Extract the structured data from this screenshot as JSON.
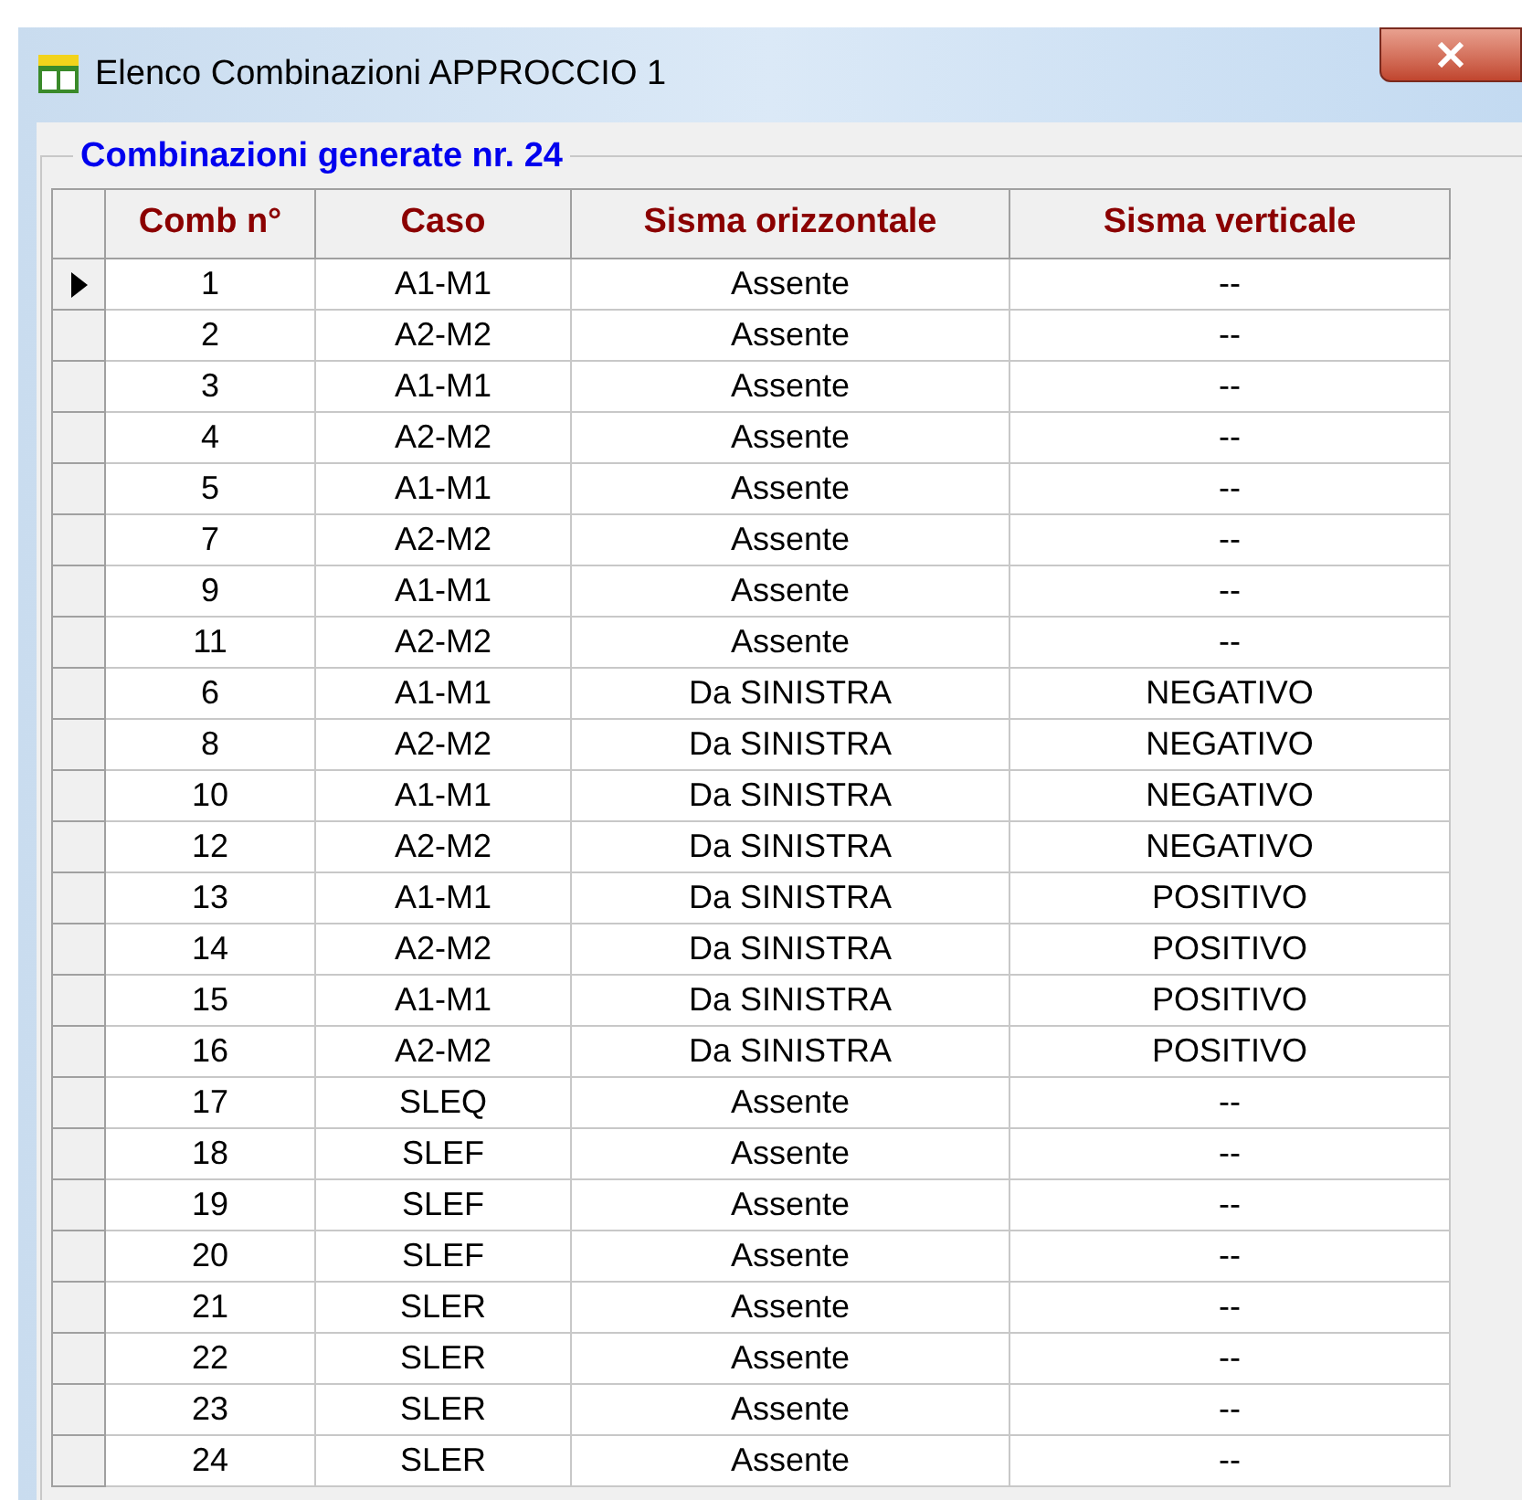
{
  "window": {
    "title": "Elenco Combinazioni APPROCCIO 1"
  },
  "group": {
    "title": "Combinazioni generate nr. 24"
  },
  "table": {
    "columns": [
      "Comb n°",
      "Caso",
      "Sisma orizzontale",
      "Sisma verticale"
    ],
    "rows": [
      {
        "cells": [
          "1",
          "A1-M1",
          "Assente",
          "--"
        ],
        "selected": true
      },
      {
        "cells": [
          "2",
          "A2-M2",
          "Assente",
          "--"
        ],
        "selected": false
      },
      {
        "cells": [
          "3",
          "A1-M1",
          "Assente",
          "--"
        ],
        "selected": false
      },
      {
        "cells": [
          "4",
          "A2-M2",
          "Assente",
          "--"
        ],
        "selected": false
      },
      {
        "cells": [
          "5",
          "A1-M1",
          "Assente",
          "--"
        ],
        "selected": false
      },
      {
        "cells": [
          "7",
          "A2-M2",
          "Assente",
          "--"
        ],
        "selected": false
      },
      {
        "cells": [
          "9",
          "A1-M1",
          "Assente",
          "--"
        ],
        "selected": false
      },
      {
        "cells": [
          "11",
          "A2-M2",
          "Assente",
          "--"
        ],
        "selected": false
      },
      {
        "cells": [
          "6",
          "A1-M1",
          "Da SINISTRA",
          "NEGATIVO"
        ],
        "selected": false
      },
      {
        "cells": [
          "8",
          "A2-M2",
          "Da SINISTRA",
          "NEGATIVO"
        ],
        "selected": false
      },
      {
        "cells": [
          "10",
          "A1-M1",
          "Da SINISTRA",
          "NEGATIVO"
        ],
        "selected": false
      },
      {
        "cells": [
          "12",
          "A2-M2",
          "Da SINISTRA",
          "NEGATIVO"
        ],
        "selected": false
      },
      {
        "cells": [
          "13",
          "A1-M1",
          "Da SINISTRA",
          "POSITIVO"
        ],
        "selected": false
      },
      {
        "cells": [
          "14",
          "A2-M2",
          "Da SINISTRA",
          "POSITIVO"
        ],
        "selected": false
      },
      {
        "cells": [
          "15",
          "A1-M1",
          "Da SINISTRA",
          "POSITIVO"
        ],
        "selected": false
      },
      {
        "cells": [
          "16",
          "A2-M2",
          "Da SINISTRA",
          "POSITIVO"
        ],
        "selected": false
      },
      {
        "cells": [
          "17",
          "SLEQ",
          "Assente",
          "--"
        ],
        "selected": false
      },
      {
        "cells": [
          "18",
          "SLEF",
          "Assente",
          "--"
        ],
        "selected": false
      },
      {
        "cells": [
          "19",
          "SLEF",
          "Assente",
          "--"
        ],
        "selected": false
      },
      {
        "cells": [
          "20",
          "SLEF",
          "Assente",
          "--"
        ],
        "selected": false
      },
      {
        "cells": [
          "21",
          "SLER",
          "Assente",
          "--"
        ],
        "selected": false
      },
      {
        "cells": [
          "22",
          "SLER",
          "Assente",
          "--"
        ],
        "selected": false
      },
      {
        "cells": [
          "23",
          "SLER",
          "Assente",
          "--"
        ],
        "selected": false
      },
      {
        "cells": [
          "24",
          "SLER",
          "Assente",
          "--"
        ],
        "selected": false
      }
    ]
  }
}
